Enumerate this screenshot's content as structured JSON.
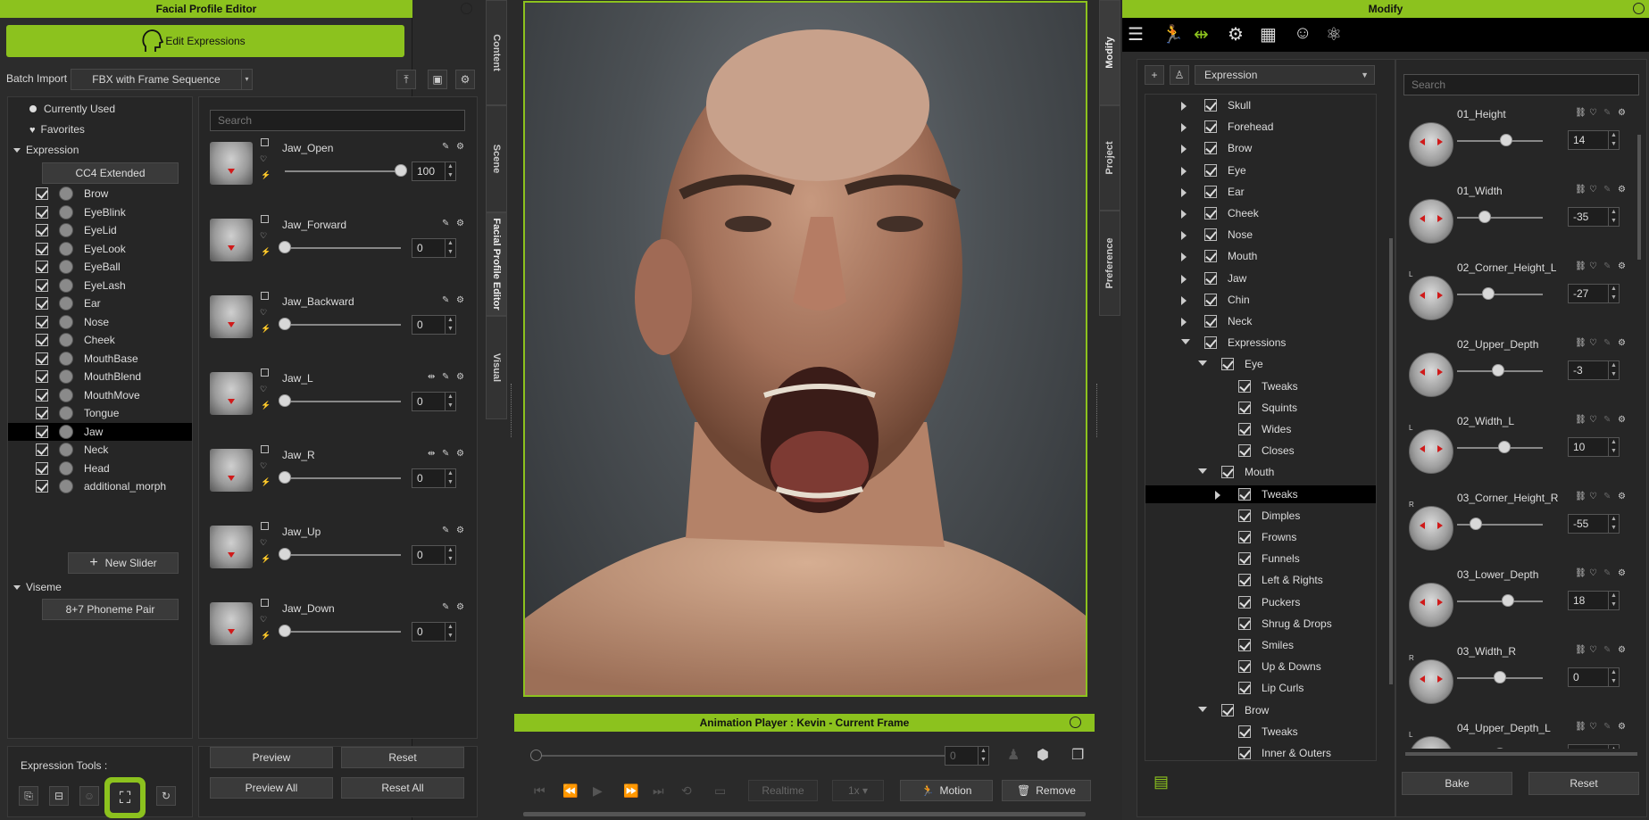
{
  "left_panel": {
    "title": "Facial Profile Editor",
    "edit_button": "Edit Expressions",
    "batch_import_label": "Batch Import :",
    "batch_import_value": "FBX with Frame Sequence",
    "currently_used": "Currently Used",
    "favorites": "Favorites",
    "expression_section": "Expression",
    "cc4_button": "CC4 Extended",
    "categories": [
      "Brow",
      "EyeBlink",
      "EyeLid",
      "EyeLook",
      "EyeBall",
      "EyeLash",
      "Ear",
      "Nose",
      "Cheek",
      "MouthBase",
      "MouthBlend",
      "MouthMove",
      "Tongue",
      "Jaw",
      "Neck",
      "Head",
      "additional_morph"
    ],
    "selected_category": "Jaw",
    "new_slider": "New Slider",
    "viseme_section": "Viseme",
    "phoneme_button": "8+7 Phoneme Pair",
    "search_placeholder": "Search",
    "sliders": [
      {
        "name": "Jaw_Open",
        "value": "100",
        "fraction": 1.0
      },
      {
        "name": "Jaw_Forward",
        "value": "0",
        "fraction": 0
      },
      {
        "name": "Jaw_Backward",
        "value": "0",
        "fraction": 0
      },
      {
        "name": "Jaw_L",
        "value": "0",
        "fraction": 0
      },
      {
        "name": "Jaw_R",
        "value": "0",
        "fraction": 0
      },
      {
        "name": "Jaw_Up",
        "value": "0",
        "fraction": 0
      },
      {
        "name": "Jaw_Down",
        "value": "0",
        "fraction": 0
      }
    ],
    "tools_label": "Expression Tools :",
    "preview": "Preview",
    "reset": "Reset",
    "preview_all": "Preview All",
    "reset_all": "Reset All"
  },
  "side_tabs": {
    "content": "Content",
    "scene": "Scene",
    "facial": "Facial Profile Editor",
    "visual": "Visual"
  },
  "right_tabs": {
    "modify": "Modify",
    "project": "Project",
    "preference": "Preference"
  },
  "anim_player": {
    "title": "Animation Player : Kevin - Current Frame",
    "frame": "0",
    "realtime": "Realtime",
    "speed": "1x",
    "motion": "Motion",
    "remove": "Remove"
  },
  "modify_panel": {
    "title": "Modify",
    "dropdown": "Expression",
    "search_placeholder": "Search",
    "tree": [
      {
        "label": "Skull",
        "level": 0,
        "arrow": "right",
        "checked": true
      },
      {
        "label": "Forehead",
        "level": 0,
        "arrow": "right",
        "checked": true
      },
      {
        "label": "Brow",
        "level": 0,
        "arrow": "right",
        "checked": true
      },
      {
        "label": "Eye",
        "level": 0,
        "arrow": "right",
        "checked": true
      },
      {
        "label": "Ear",
        "level": 0,
        "arrow": "right",
        "checked": true
      },
      {
        "label": "Cheek",
        "level": 0,
        "arrow": "right",
        "checked": true
      },
      {
        "label": "Nose",
        "level": 0,
        "arrow": "right",
        "checked": true
      },
      {
        "label": "Mouth",
        "level": 0,
        "arrow": "right",
        "checked": true
      },
      {
        "label": "Jaw",
        "level": 0,
        "arrow": "right",
        "checked": true
      },
      {
        "label": "Chin",
        "level": 0,
        "arrow": "right",
        "checked": true
      },
      {
        "label": "Neck",
        "level": 0,
        "arrow": "right",
        "checked": true
      },
      {
        "label": "Expressions",
        "level": 0,
        "arrow": "down",
        "checked": true
      },
      {
        "label": "Eye",
        "level": 1,
        "arrow": "down",
        "checked": true
      },
      {
        "label": "Tweaks",
        "level": 2,
        "arrow": "",
        "checked": true
      },
      {
        "label": "Squints",
        "level": 2,
        "arrow": "",
        "checked": true
      },
      {
        "label": "Wides",
        "level": 2,
        "arrow": "",
        "checked": true
      },
      {
        "label": "Closes",
        "level": 2,
        "arrow": "",
        "checked": true
      },
      {
        "label": "Mouth",
        "level": 1,
        "arrow": "down",
        "checked": true
      },
      {
        "label": "Tweaks",
        "level": 2,
        "arrow": "right",
        "checked": true,
        "selected": true
      },
      {
        "label": "Dimples",
        "level": 2,
        "arrow": "",
        "checked": true
      },
      {
        "label": "Frowns",
        "level": 2,
        "arrow": "",
        "checked": true
      },
      {
        "label": "Funnels",
        "level": 2,
        "arrow": "",
        "checked": true
      },
      {
        "label": "Left & Rights",
        "level": 2,
        "arrow": "",
        "checked": true
      },
      {
        "label": "Puckers",
        "level": 2,
        "arrow": "",
        "checked": true
      },
      {
        "label": "Shrug & Drops",
        "level": 2,
        "arrow": "",
        "checked": true
      },
      {
        "label": "Smiles",
        "level": 2,
        "arrow": "",
        "checked": true
      },
      {
        "label": "Up & Downs",
        "level": 2,
        "arrow": "",
        "checked": true
      },
      {
        "label": "Lip Curls",
        "level": 2,
        "arrow": "",
        "checked": true
      },
      {
        "label": "Brow",
        "level": 1,
        "arrow": "down",
        "checked": true
      },
      {
        "label": "Tweaks",
        "level": 2,
        "arrow": "",
        "checked": true
      },
      {
        "label": "Inner & Outers",
        "level": 2,
        "arrow": "",
        "checked": true
      }
    ],
    "morphs": [
      {
        "name": "01_Height",
        "side": "",
        "value": "14",
        "fraction": 0.57
      },
      {
        "name": "01_Width",
        "side": "",
        "value": "-35",
        "fraction": 0.32
      },
      {
        "name": "02_Corner_Height_L",
        "side": "L",
        "value": "-27",
        "fraction": 0.36
      },
      {
        "name": "02_Upper_Depth",
        "side": "",
        "value": "-3",
        "fraction": 0.48
      },
      {
        "name": "02_Width_L",
        "side": "L",
        "value": "10",
        "fraction": 0.55
      },
      {
        "name": "03_Corner_Height_R",
        "side": "R",
        "value": "-55",
        "fraction": 0.22
      },
      {
        "name": "03_Lower_Depth",
        "side": "",
        "value": "18",
        "fraction": 0.59
      },
      {
        "name": "03_Width_R",
        "side": "R",
        "value": "0",
        "fraction": 0.5
      },
      {
        "name": "04_Upper_Depth_L",
        "side": "L",
        "value": "",
        "fraction": 0.5
      }
    ],
    "bake": "Bake",
    "reset": "Reset"
  }
}
